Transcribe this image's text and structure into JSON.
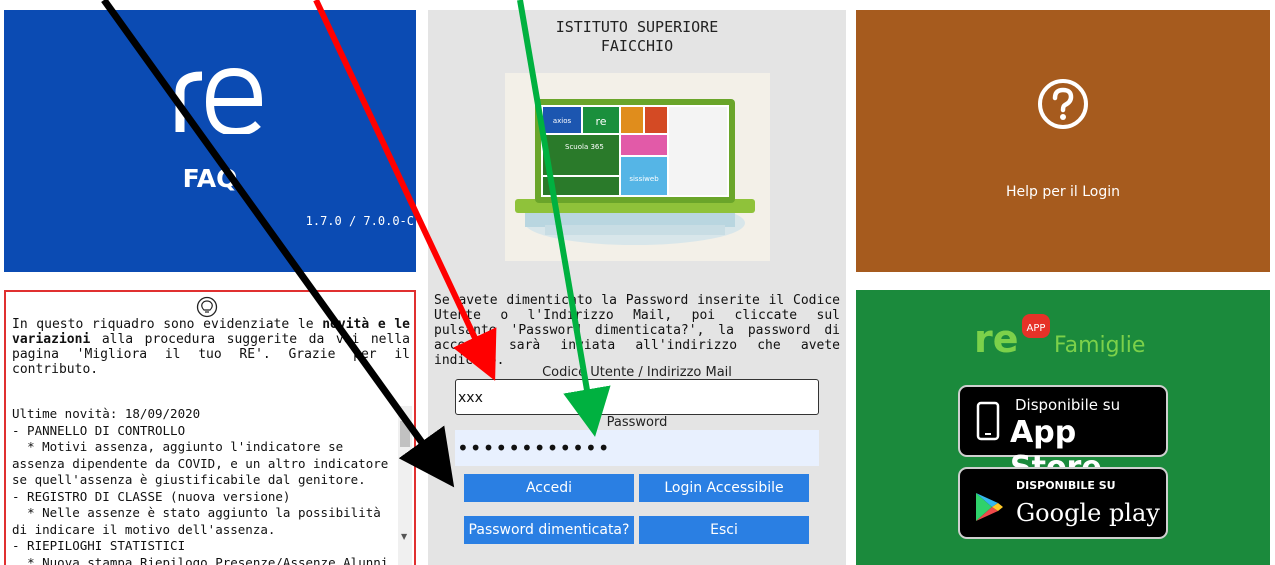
{
  "faq_tile": {
    "logo_text": "re",
    "label": "FAQ",
    "version": "1.7.0 / 7.0.0-C"
  },
  "login": {
    "school_line1": "ISTITUTO SUPERIORE",
    "school_line2": "FAICCHIO",
    "info_text": "Se avete dimenticato la Password inserite il Codice Utente o l'Indirizzo Mail, poi cliccate sul pulsante 'Password dimenticata?', la password di accesso sarà inviata all'indirizzo che avete indicato.",
    "user_label": "Codice Utente / Indirizzo Mail",
    "user_value": "xxx",
    "password_label": "Password",
    "password_value": "••••••••••••",
    "btn_accedi": "Accedi",
    "btn_accessibile": "Login Accessibile",
    "btn_forgot": "Password dimenticata?",
    "btn_esci": "Esci",
    "screen_tiles": [
      "axios",
      "re",
      "Scuola 365",
      "sissiweb"
    ]
  },
  "help_tile": {
    "label": "Help per il Login"
  },
  "news": {
    "intro_a": "In questo riquadro sono evidenziate le ",
    "intro_b": "novità e le variazioni",
    "intro_c": " alla procedura suggerite da voi nella pagina 'Migliora il tuo RE'. Grazie per il contributo.",
    "log": "Ultime novità: 18/09/2020\n- PANNELLO DI CONTROLLO\n  * Motivi assenza, aggiunto l'indicatore se assenza dipendente da COVID, e un altro indicatore se quell'assenza è giustificabile dal genitore.\n- REGISTRO DI CLASSE (nuova versione)\n  * Nelle assenze è stato aggiunto la possibilità di indicare il motivo dell'assenza.\n- RIEPILOGHI STATISTICI\n  * Nuova stampa Riepilogo Presenze/Assenze Alunni"
  },
  "app_tile": {
    "brand_logo": "re",
    "brand_badge": "APP",
    "brand_name": "Famiglie",
    "appstore_small": "Disponibile su",
    "appstore_big": "App Store",
    "gplay_small": "DISPONIBILE SU",
    "gplay_big": "Google play"
  },
  "colors": {
    "faq_blue": "#0b4bb3",
    "help_brown": "#a65b1e",
    "app_green": "#1b8a3c",
    "button_blue": "#2a7fe3",
    "news_border": "#e03030",
    "arrow_red": "#ff0000",
    "arrow_green": "#00b140",
    "arrow_black": "#000000"
  }
}
